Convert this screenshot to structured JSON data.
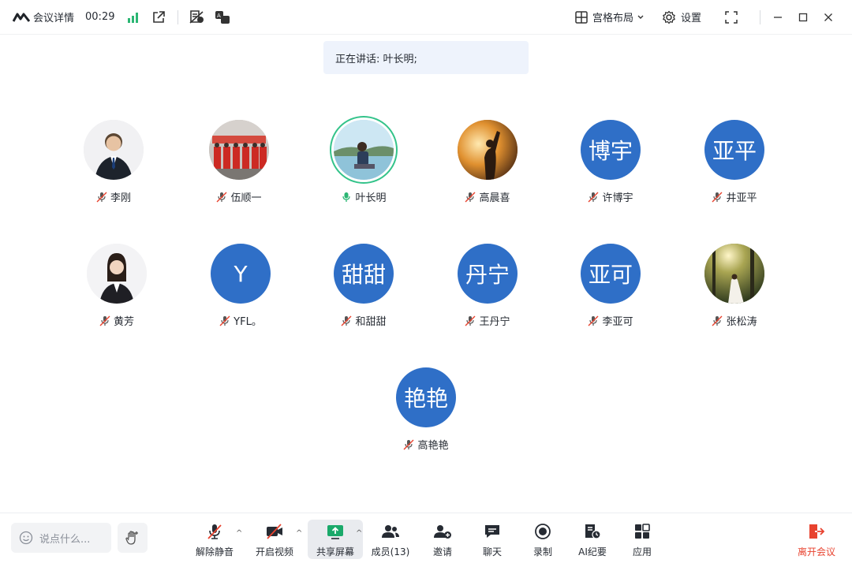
{
  "topbar": {
    "title": "会议详情",
    "timer": "00:29",
    "layout_label": "宫格布局",
    "settings_label": "设置"
  },
  "speaking": {
    "text": "正在讲话: 叶长明;"
  },
  "participants": [
    {
      "name": "李刚",
      "avatar_text": "",
      "avatar_kind": "photo",
      "muted": true
    },
    {
      "name": "伍顺一",
      "avatar_text": "",
      "avatar_kind": "photo",
      "muted": true
    },
    {
      "name": "叶长明",
      "avatar_text": "",
      "avatar_kind": "photo",
      "muted": false,
      "speaking": true
    },
    {
      "name": "高晨喜",
      "avatar_text": "",
      "avatar_kind": "photo",
      "muted": true
    },
    {
      "name": "许博宇",
      "avatar_text": "博宇",
      "avatar_kind": "text",
      "muted": true
    },
    {
      "name": "井亚平",
      "avatar_text": "亚平",
      "avatar_kind": "text",
      "muted": true
    },
    {
      "name": "黄芳",
      "avatar_text": "",
      "avatar_kind": "photo",
      "muted": true
    },
    {
      "name": "YFL。",
      "avatar_text": "Y",
      "avatar_kind": "text",
      "muted": true
    },
    {
      "name": "和甜甜",
      "avatar_text": "甜甜",
      "avatar_kind": "text",
      "muted": true
    },
    {
      "name": "王丹宁",
      "avatar_text": "丹宁",
      "avatar_kind": "text",
      "muted": true
    },
    {
      "name": "李亚可",
      "avatar_text": "亚可",
      "avatar_kind": "text",
      "muted": true
    },
    {
      "name": "张松涛",
      "avatar_text": "",
      "avatar_kind": "photo",
      "muted": true
    },
    {
      "name": "高艳艳",
      "avatar_text": "艳艳",
      "avatar_kind": "text",
      "muted": true
    }
  ],
  "bottombar": {
    "chat_placeholder": "说点什么...",
    "tools": {
      "unmute": "解除静音",
      "start_video": "开启视频",
      "share_screen": "共享屏幕",
      "members": "成员(13)",
      "invite": "邀请",
      "chat": "聊天",
      "record": "录制",
      "ai_minutes": "AI纪要",
      "apps": "应用"
    },
    "leave": "离开会议"
  },
  "colors": {
    "avatar_blue": "#2f6fc7",
    "speaking_ring": "#33c38a",
    "leave_red": "#e8432f",
    "banner_bg": "#eef3fc"
  }
}
